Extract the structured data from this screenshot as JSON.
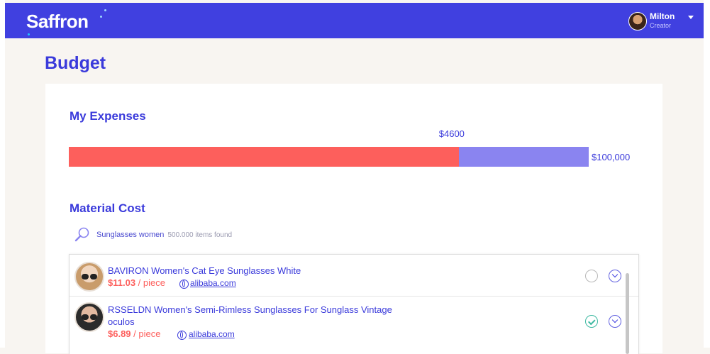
{
  "app": {
    "name": "Saffron"
  },
  "user": {
    "name": "Milton",
    "role": "Creator"
  },
  "page": {
    "title": "Budget"
  },
  "expenses": {
    "title": "My Expenses",
    "spent_label": "$4600",
    "total_label": "$100,000",
    "spent_fraction": 0.75,
    "colors": {
      "spent": "#fd5f5c",
      "remaining": "#8a84f0"
    }
  },
  "material": {
    "title": "Material Cost",
    "search_query": "Sunglasses women",
    "results_count": "500.000 items found",
    "items": [
      {
        "title": "BAVIRON Women's Cat Eye Sunglasses White",
        "price": "$11.03",
        "unit": "/ piece",
        "source": "alibaba.com",
        "selected": false
      },
      {
        "title_line1": "RSSELDN Women's Semi-Rimless Sunglasses For Sunglass Vintage",
        "title_line2": "oculos",
        "price": "$6.89",
        "unit": "/ piece",
        "source": "alibaba.com",
        "selected": true
      }
    ]
  },
  "icons": {
    "search": "magnifier-icon",
    "globe": "globe-icon",
    "expand": "chevron-down-icon",
    "check": "check-icon",
    "caret": "caret-down-icon"
  }
}
